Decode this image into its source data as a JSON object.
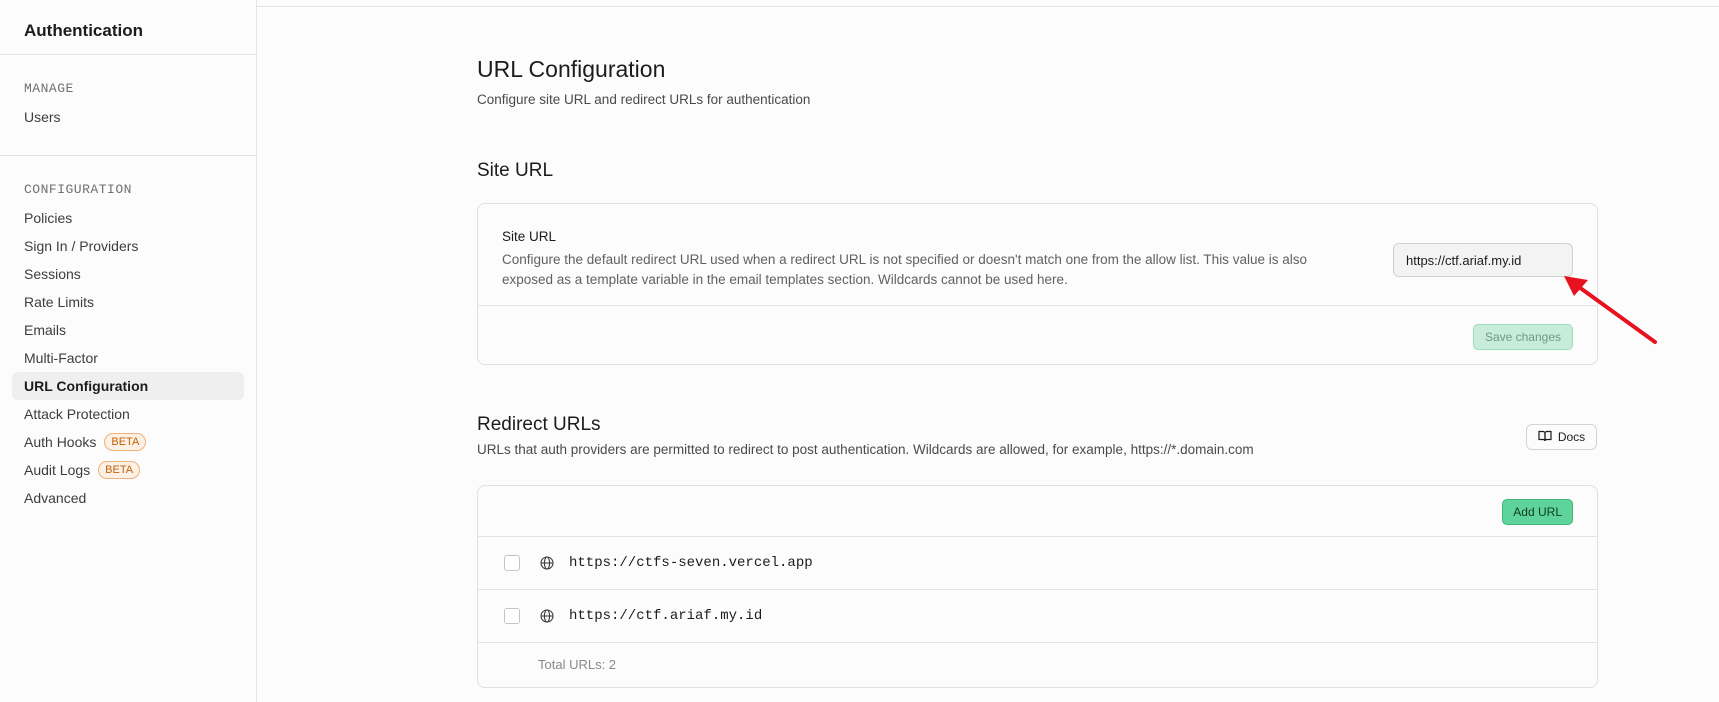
{
  "sidebar": {
    "title": "Authentication",
    "manage": {
      "title": "MANAGE",
      "items": [
        {
          "label": "Users"
        }
      ]
    },
    "configuration": {
      "title": "CONFIGURATION",
      "items": [
        {
          "label": "Policies"
        },
        {
          "label": "Sign In / Providers"
        },
        {
          "label": "Sessions"
        },
        {
          "label": "Rate Limits"
        },
        {
          "label": "Emails"
        },
        {
          "label": "Multi-Factor"
        },
        {
          "label": "URL Configuration"
        },
        {
          "label": "Attack Protection"
        },
        {
          "label": "Auth Hooks",
          "badge": "BETA"
        },
        {
          "label": "Audit Logs",
          "badge": "BETA"
        },
        {
          "label": "Advanced"
        }
      ]
    }
  },
  "page": {
    "title": "URL Configuration",
    "subtitle": "Configure site URL and redirect URLs for authentication"
  },
  "site_url": {
    "heading": "Site URL",
    "label": "Site URL",
    "description": "Configure the default redirect URL used when a redirect URL is not specified or doesn't match one from the allow list. This value is also exposed as a template variable in the email templates section. Wildcards cannot be used here.",
    "value": "https://ctf.ariaf.my.id",
    "save_label": "Save changes"
  },
  "redirect_urls": {
    "heading": "Redirect URLs",
    "description": "URLs that auth providers are permitted to redirect to post authentication. Wildcards are allowed, for example, https://*.domain.com",
    "docs_label": "Docs",
    "add_label": "Add URL",
    "items": [
      {
        "url": "https://ctfs-seven.vercel.app"
      },
      {
        "url": "https://ctf.ariaf.my.id"
      }
    ],
    "total_label": "Total URLs: 2"
  },
  "colors": {
    "accent_green": "#5fd49a",
    "annotation_red": "#e8121e"
  }
}
